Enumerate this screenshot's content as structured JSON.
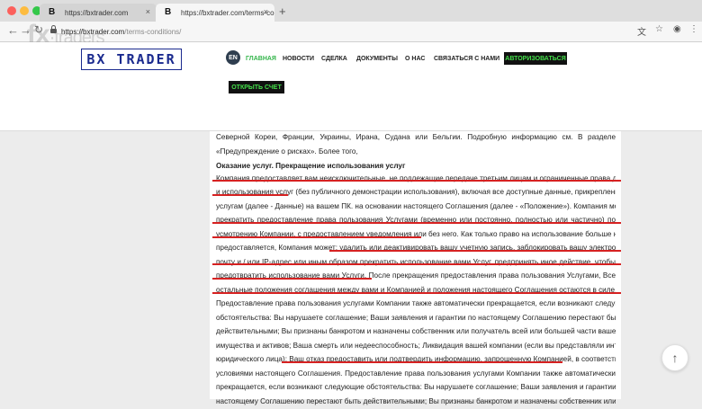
{
  "browser": {
    "tabs": [
      {
        "favicon": "B",
        "title": "https://bxtrader.com"
      },
      {
        "favicon": "B",
        "title": "https://bxtrader.com/terms-co"
      }
    ],
    "new_tab": "+",
    "close_glyph": "×",
    "url_host": "https://bxtrader.com",
    "url_path": "/terms-conditions/",
    "icons": [
      "back-icon",
      "forward-icon",
      "reload-icon",
      "lock-icon",
      "translate-icon",
      "star-icon",
      "account-icon",
      "menu-icon"
    ]
  },
  "watermark": {
    "brand": "fx",
    "sub": "traders"
  },
  "site": {
    "logo": "BX TRADER",
    "lang": "EN",
    "nav": [
      {
        "label": "ГЛАВНАЯ"
      },
      {
        "label": "НОВОСТИ"
      },
      {
        "label": "СДЕЛКА"
      },
      {
        "label": "ДОКУМЕНТЫ"
      },
      {
        "label": "О НАС"
      },
      {
        "label": "СВЯЗАТЬСЯ С НАМИ"
      }
    ],
    "auth_button": "АВТОРИЗОВАТЬСЯ",
    "open_account_button": "ОТКРЫТЬ СЧЕТ",
    "accent_color": "#33b54a"
  },
  "content": {
    "lines": [
      "Северной Кореи, Франции, Украины, Ирана, Судана или Бельгии. Подробную информацию см. В разделе",
      "«Предупреждение о рисках». Более того,",
      "Оказание услуг. Прекращение использования услуг",
      "Компания предоставляет вам неисключительные, не подлежащие передаче третьим лицам и ограниченные права доступа",
      "и использования услуг (без публичного демонстрации использования), включая все доступные данные, прикрепленные к",
      "услугам (далее - Данные) на вашем ПК. на основании настоящего Соглашения (далее - «Положение»). Компания может",
      "прекратить предоставление права пользования Услугами (временно или постоянно, полностью или частично) по",
      "усмотрению Компании, с предоставлением уведомления или без него. Как только право на использование больше не",
      "предоставляется, Компания может: удалить или деактивировать вашу учетную запись, заблокировать вашу электронную",
      "почту и / или IP-адрес или иным образом прекратить использование вами Услуг, предпринять иное действие, чтобы",
      "предотвратить использование вами Услуги. После прекращения предоставления права пользования Услугами, Все",
      "остальные положения соглашения между вами и Компанией и положения настоящего Соглашения остаются в силе.",
      "Предоставление права пользования услугами Компании также автоматически прекращается, если возникают следующие",
      "обстоятельства: Вы нарушаете соглашение; Ваши заявления и гарантии по настоящему Соглашению перестают быть",
      "действительными; Вы признаны банкротом и назначены собственник или получатель всей или большей части вашего",
      "имущества и активов; Ваша смерть или недееспособность; Ликвидация вашей компании (если вы представляли интересы",
      "юридического лица); Ваш отказ предоставить или подтвердить информацию, запрошенную Компанией, в соответствии с",
      "условиями настоящего Соглашения. Предоставление права пользования услугами Компании также автоматически",
      "прекращается, если возникают следующие обстоятельства: Вы нарушаете соглашение; Ваши заявления и гарантии по",
      "настоящему Соглашению перестают быть действительными; Вы признаны банкротом и назначены собственник или"
    ]
  },
  "scroll_top": "↑"
}
